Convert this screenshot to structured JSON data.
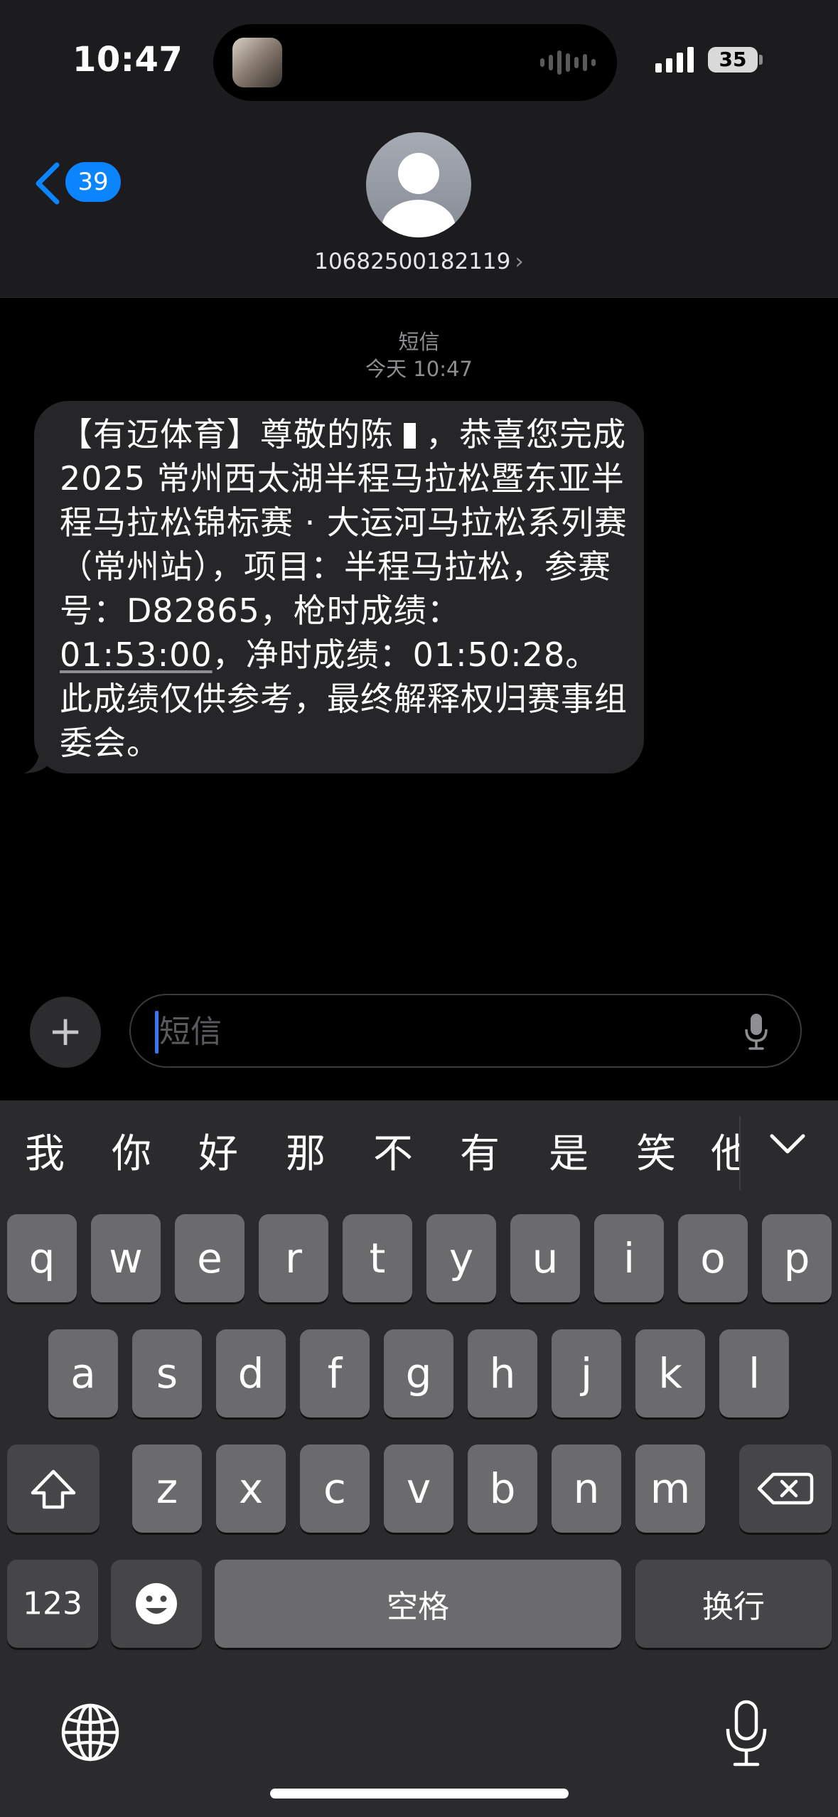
{
  "status_bar": {
    "time": "10:47",
    "battery": "35"
  },
  "nav": {
    "back_count": "39",
    "contact": "10682500182119",
    "contact_chevron": "›"
  },
  "thread": {
    "timestamp_type": "短信",
    "timestamp_time": "今天 10:47",
    "message_part1": "【有迈体育】尊敬的陈",
    "message_part2": "，恭喜您完成 2025 常州西太湖半程马拉松暨东亚半程马拉松锦标赛 · 大运河马拉松系列赛（常州站），项目：半程马拉松，参赛号：D82865，枪时成绩：",
    "gun_time": "01:53:00",
    "message_part3": "，净时成绩：01:50:28。此成绩仅供参考，最终解释权归赛事组委会。"
  },
  "composer": {
    "plus": "+",
    "placeholder": "短信"
  },
  "keyboard": {
    "candidates": [
      "我",
      "你",
      "好",
      "那",
      "不",
      "有",
      "是",
      "笑",
      "他"
    ],
    "row1": [
      "q",
      "w",
      "e",
      "r",
      "t",
      "y",
      "u",
      "i",
      "o",
      "p"
    ],
    "row2": [
      "a",
      "s",
      "d",
      "f",
      "g",
      "h",
      "j",
      "k",
      "l"
    ],
    "row3": [
      "z",
      "x",
      "c",
      "v",
      "b",
      "n",
      "m"
    ],
    "numbers": "123",
    "space": "空格",
    "return": "换行"
  }
}
